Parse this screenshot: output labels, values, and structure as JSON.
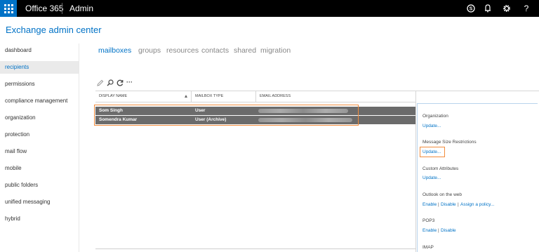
{
  "topbar": {
    "brand": "Office 365",
    "app": "Admin",
    "icons": [
      "app-launcher-icon",
      "skype-icon",
      "notification-bell-icon",
      "settings-gear-icon",
      "help-icon"
    ]
  },
  "page": {
    "title": "Exchange admin center"
  },
  "nav": {
    "items": [
      {
        "label": "dashboard",
        "active": false
      },
      {
        "label": "recipients",
        "active": true
      },
      {
        "label": "permissions",
        "active": false
      },
      {
        "label": "compliance management",
        "active": false
      },
      {
        "label": "organization",
        "active": false
      },
      {
        "label": "protection",
        "active": false
      },
      {
        "label": "mail flow",
        "active": false
      },
      {
        "label": "mobile",
        "active": false
      },
      {
        "label": "public folders",
        "active": false
      },
      {
        "label": "unified messaging",
        "active": false
      },
      {
        "label": "hybrid",
        "active": false
      }
    ]
  },
  "tabs": [
    {
      "label": "mailboxes",
      "active": true
    },
    {
      "label": "groups",
      "active": false
    },
    {
      "label": "resources",
      "active": false
    },
    {
      "label": "contacts",
      "active": false
    },
    {
      "label": "shared",
      "active": false
    },
    {
      "label": "migration",
      "active": false
    }
  ],
  "toolbar": {
    "icons": [
      "edit-pencil-icon",
      "search-icon",
      "refresh-icon",
      "more-options-icon"
    ],
    "more_label": "···"
  },
  "table": {
    "columns": [
      "DISPLAY NAME",
      "MAILBOX TYPE",
      "EMAIL ADDRESS"
    ],
    "rows": [
      {
        "display_name": "Som Singh",
        "mailbox_type": "User"
      },
      {
        "display_name": "Somendra Kumar",
        "mailbox_type": "User (Archive)"
      }
    ]
  },
  "details": {
    "sections": [
      {
        "label": "Organization",
        "link": "Update..."
      },
      {
        "label": "Message Size Restrictions",
        "link": "Update..."
      },
      {
        "label": "Custom Attributes",
        "link": "Update..."
      },
      {
        "label": "Outlook on the web",
        "links": [
          "Enable",
          "Disable",
          "Assign a policy..."
        ]
      },
      {
        "label": "POP3",
        "links": [
          "Enable",
          "Disable"
        ]
      },
      {
        "label": "IMAP"
      }
    ],
    "pipe": "|"
  },
  "colors": {
    "accent": "#0072c6",
    "topbar": "#000000",
    "selected_row": "#6b6b6b",
    "highlight": "#f28c3c"
  }
}
